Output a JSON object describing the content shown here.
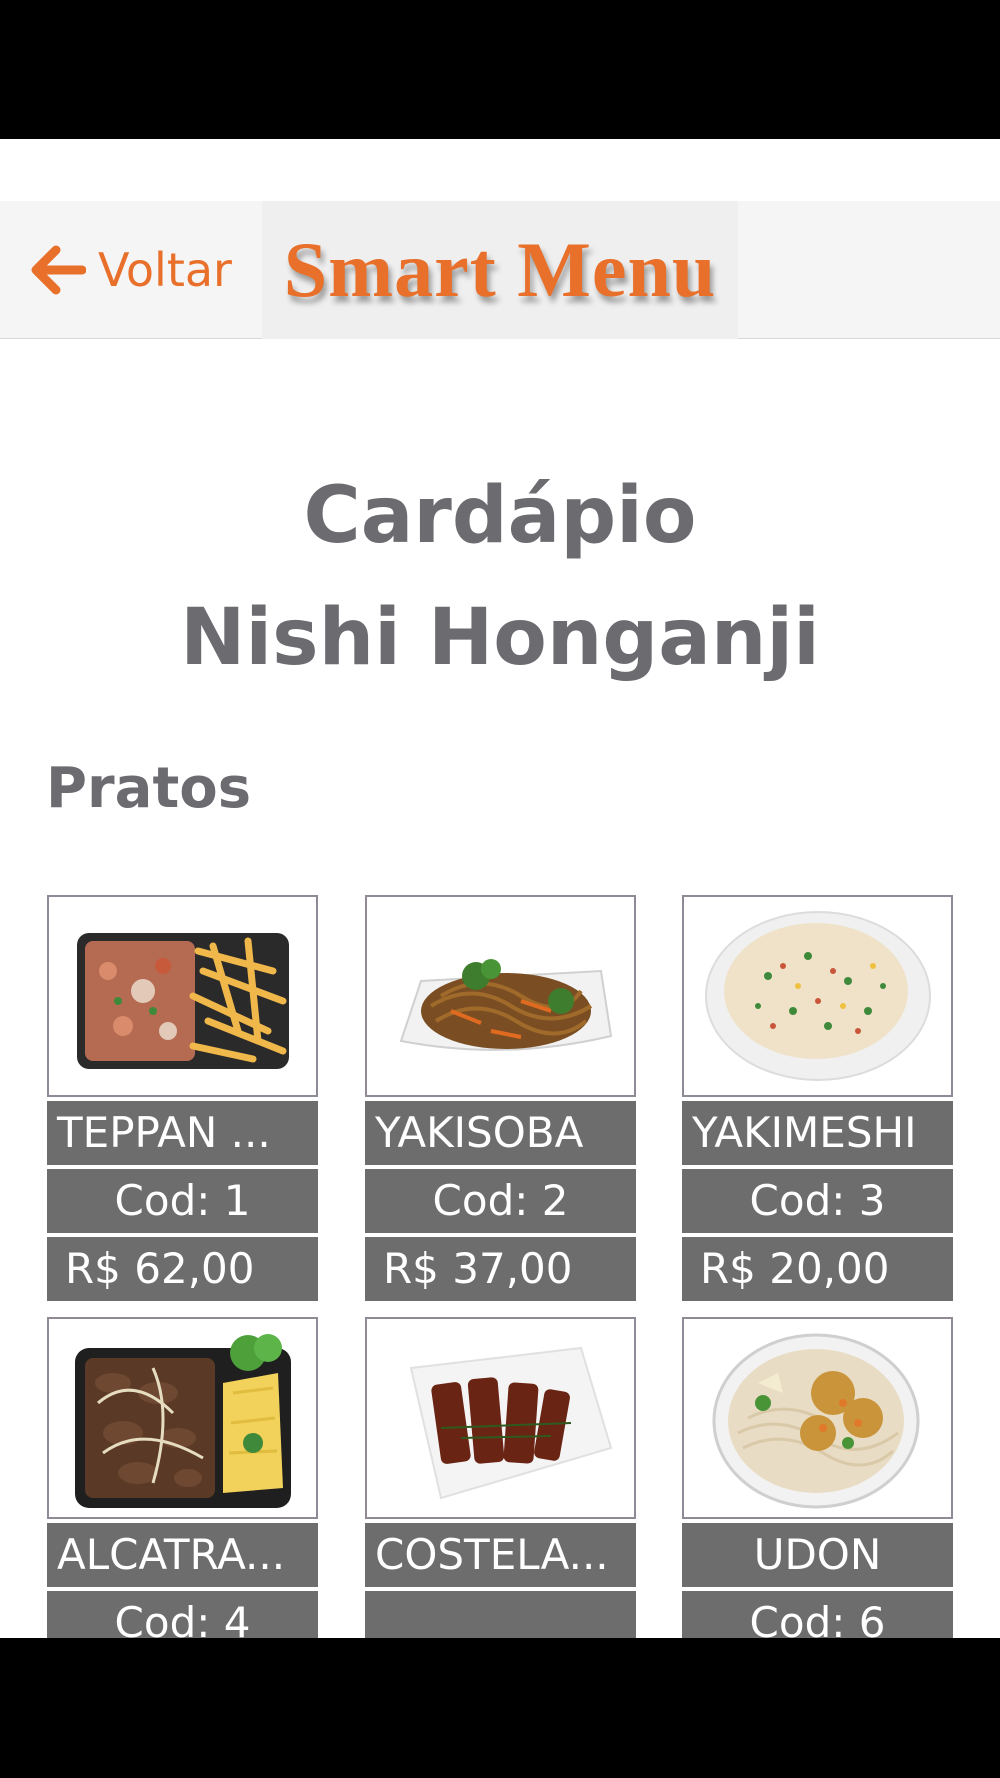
{
  "header": {
    "back_label": "Voltar",
    "brand_title": "Smart Menu",
    "accent_color": "#e8702a"
  },
  "page": {
    "title_line1": "Cardápio",
    "title_line2": "Nishi Honganji",
    "section_title": "Pratos"
  },
  "dishes": [
    {
      "name": "TEPPAN ...",
      "code": "Cod:  1",
      "price": "R$  62,00",
      "image": "teppan-platter"
    },
    {
      "name": "YAKISOBA",
      "code": "Cod:  2",
      "price": "R$  37,00",
      "image": "yakisoba-plate"
    },
    {
      "name": "YAKIMESHI",
      "code": "Cod:  3",
      "price": "R$  20,00",
      "image": "fried-rice-plate"
    },
    {
      "name": "ALCATRA...",
      "code": "Cod:  4",
      "price": "",
      "image": "alcatra-platter"
    },
    {
      "name": "COSTELA...",
      "code": "",
      "price": "",
      "image": "ribs-plate"
    },
    {
      "name": "UDON",
      "code": "Cod:  6",
      "price": "",
      "image": "udon-bowl"
    }
  ]
}
